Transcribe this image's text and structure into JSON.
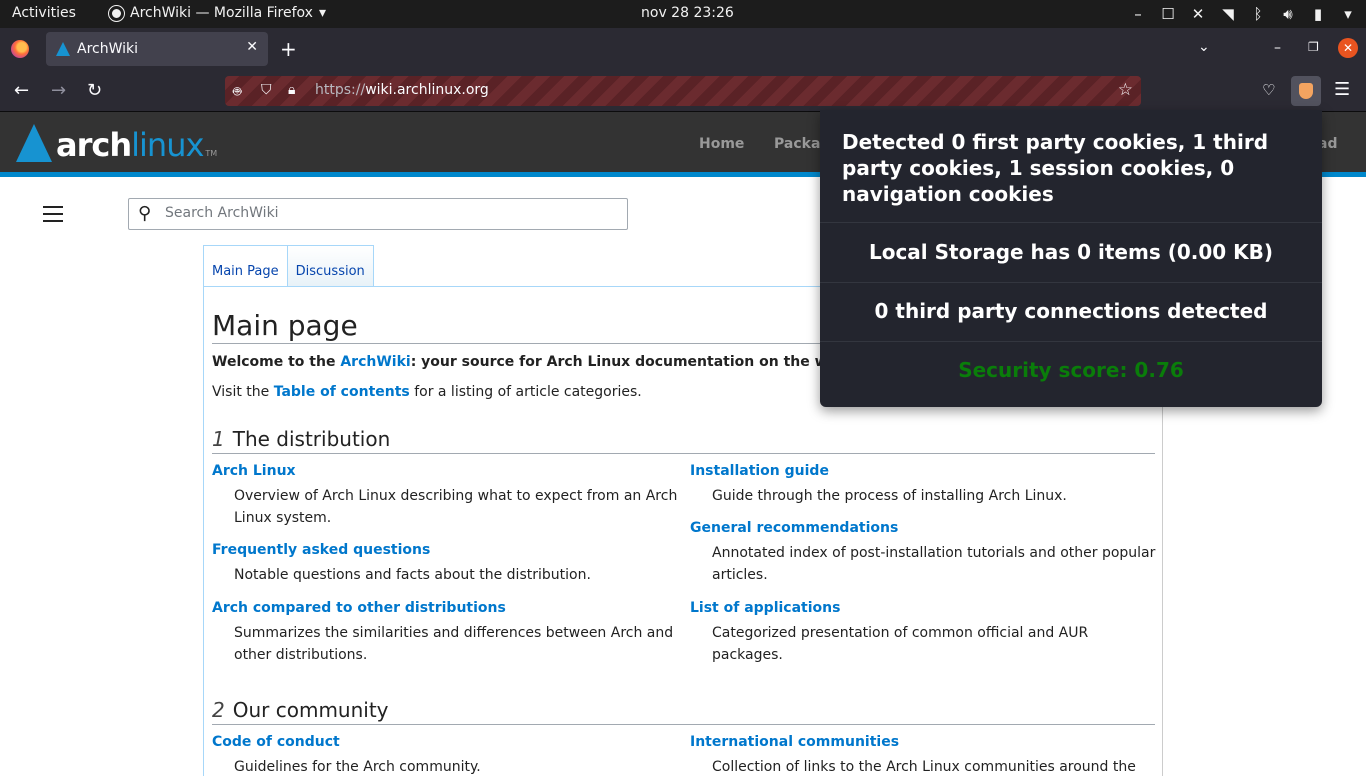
{
  "topbar": {
    "activities": "Activities",
    "app_name": "ArchWiki — Mozilla Firefox",
    "clock": "nov 28  23:26"
  },
  "browser": {
    "tab_title": "ArchWiki",
    "url_scheme": "https://",
    "url_domain": "wiki.archlinux.org"
  },
  "arch_header": {
    "logo_part1": "arch",
    "logo_part2": "linux",
    "logo_tm": "TM",
    "nav": {
      "home": "Home",
      "packages": "Packa",
      "download": "ad"
    }
  },
  "search": {
    "placeholder": "Search ArchWiki"
  },
  "page_tabs": {
    "main_page": "Main Page",
    "discussion": "Discussion"
  },
  "page": {
    "title": "Main page",
    "welcome_prefix": "Welcome to the ",
    "welcome_link": "ArchWiki",
    "welcome_suffix": ": your source for Arch Linux documentation on the w",
    "visit_prefix": "Visit the ",
    "visit_link": "Table of contents",
    "visit_suffix": " for a listing of article categories."
  },
  "sections": [
    {
      "number": "1",
      "title": "The distribution",
      "items": [
        {
          "title": "Arch Linux",
          "desc": "Overview of Arch Linux describing what to expect from an Arch Linux system."
        },
        {
          "title": "Frequently asked questions",
          "desc": "Notable questions and facts about the distribution."
        },
        {
          "title": "Arch compared to other distributions",
          "desc": "Summarizes the similarities and differences between Arch and other distributions."
        },
        {
          "title": "Installation guide",
          "desc": "Guide through the process of installing Arch Linux."
        },
        {
          "title": "General recommendations",
          "desc": "Annotated index of post-installation tutorials and other popular articles."
        },
        {
          "title": "List of applications",
          "desc": "Categorized presentation of common official and AUR packages."
        }
      ]
    },
    {
      "number": "2",
      "title": "Our community",
      "items": [
        {
          "title": "Code of conduct",
          "desc": "Guidelines for the Arch community."
        },
        {
          "title": "International communities",
          "desc": "Collection of links to the Arch Linux communities around the"
        }
      ]
    }
  ],
  "popup": {
    "cookies": "Detected 0 first party cookies, 1 third party cookies, 1 session cookies, 0 navigation cookies",
    "local_storage": "Local Storage has 0 items (0.00 KB)",
    "connections": "0 third party connections detected",
    "score": "Security score: 0.76",
    "score_color": "#0a7d0a"
  }
}
